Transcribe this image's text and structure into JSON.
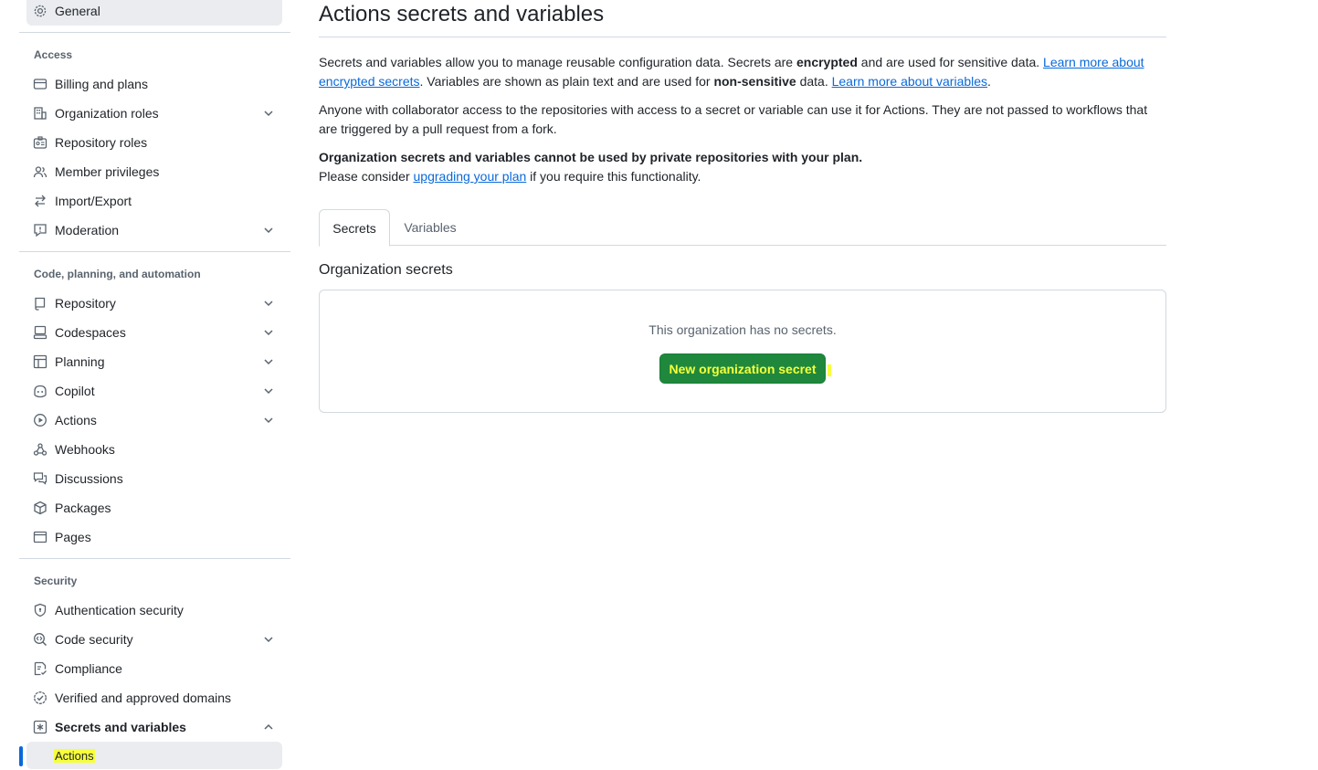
{
  "sidebar": {
    "general": "General",
    "access_title": "Access",
    "access": [
      "Billing and plans",
      "Organization roles",
      "Repository roles",
      "Member privileges",
      "Import/Export",
      "Moderation"
    ],
    "code_title": "Code, planning, and automation",
    "code": [
      "Repository",
      "Codespaces",
      "Planning",
      "Copilot",
      "Actions",
      "Webhooks",
      "Discussions",
      "Packages",
      "Pages"
    ],
    "security_title": "Security",
    "security": [
      "Authentication security",
      "Code security",
      "Compliance",
      "Verified and approved domains",
      "Secrets and variables"
    ],
    "sub_active": "Actions"
  },
  "main": {
    "title": "Actions secrets and variables",
    "p1": {
      "t1": "Secrets and variables allow you to manage reusable configuration data. Secrets are ",
      "b1": "encrypted",
      "t2": " and are used for sensitive data. ",
      "link1": "Learn more about encrypted secrets",
      "t3": ". Variables are shown as plain text and are used for ",
      "b2": "non-sensitive",
      "t4": " data. ",
      "link2": "Learn more about variables",
      "t5": "."
    },
    "p2": "Anyone with collaborator access to the repositories with access to a secret or variable can use it for Actions. They are not passed to workflows that are triggered by a pull request from a fork.",
    "p3_bold": "Organization secrets and variables cannot be used by private repositories with your plan.",
    "p3_t1": "Please consider ",
    "p3_link": "upgrading your plan",
    "p3_t2": " if you require this functionality.",
    "tabs": [
      "Secrets",
      "Variables"
    ],
    "section": "Organization secrets",
    "empty": "This organization has no secrets.",
    "button": "New organization secret"
  },
  "colors": {
    "accent": "#0969da",
    "primary": "#1f883d",
    "highlight": "#f6ff3a"
  }
}
